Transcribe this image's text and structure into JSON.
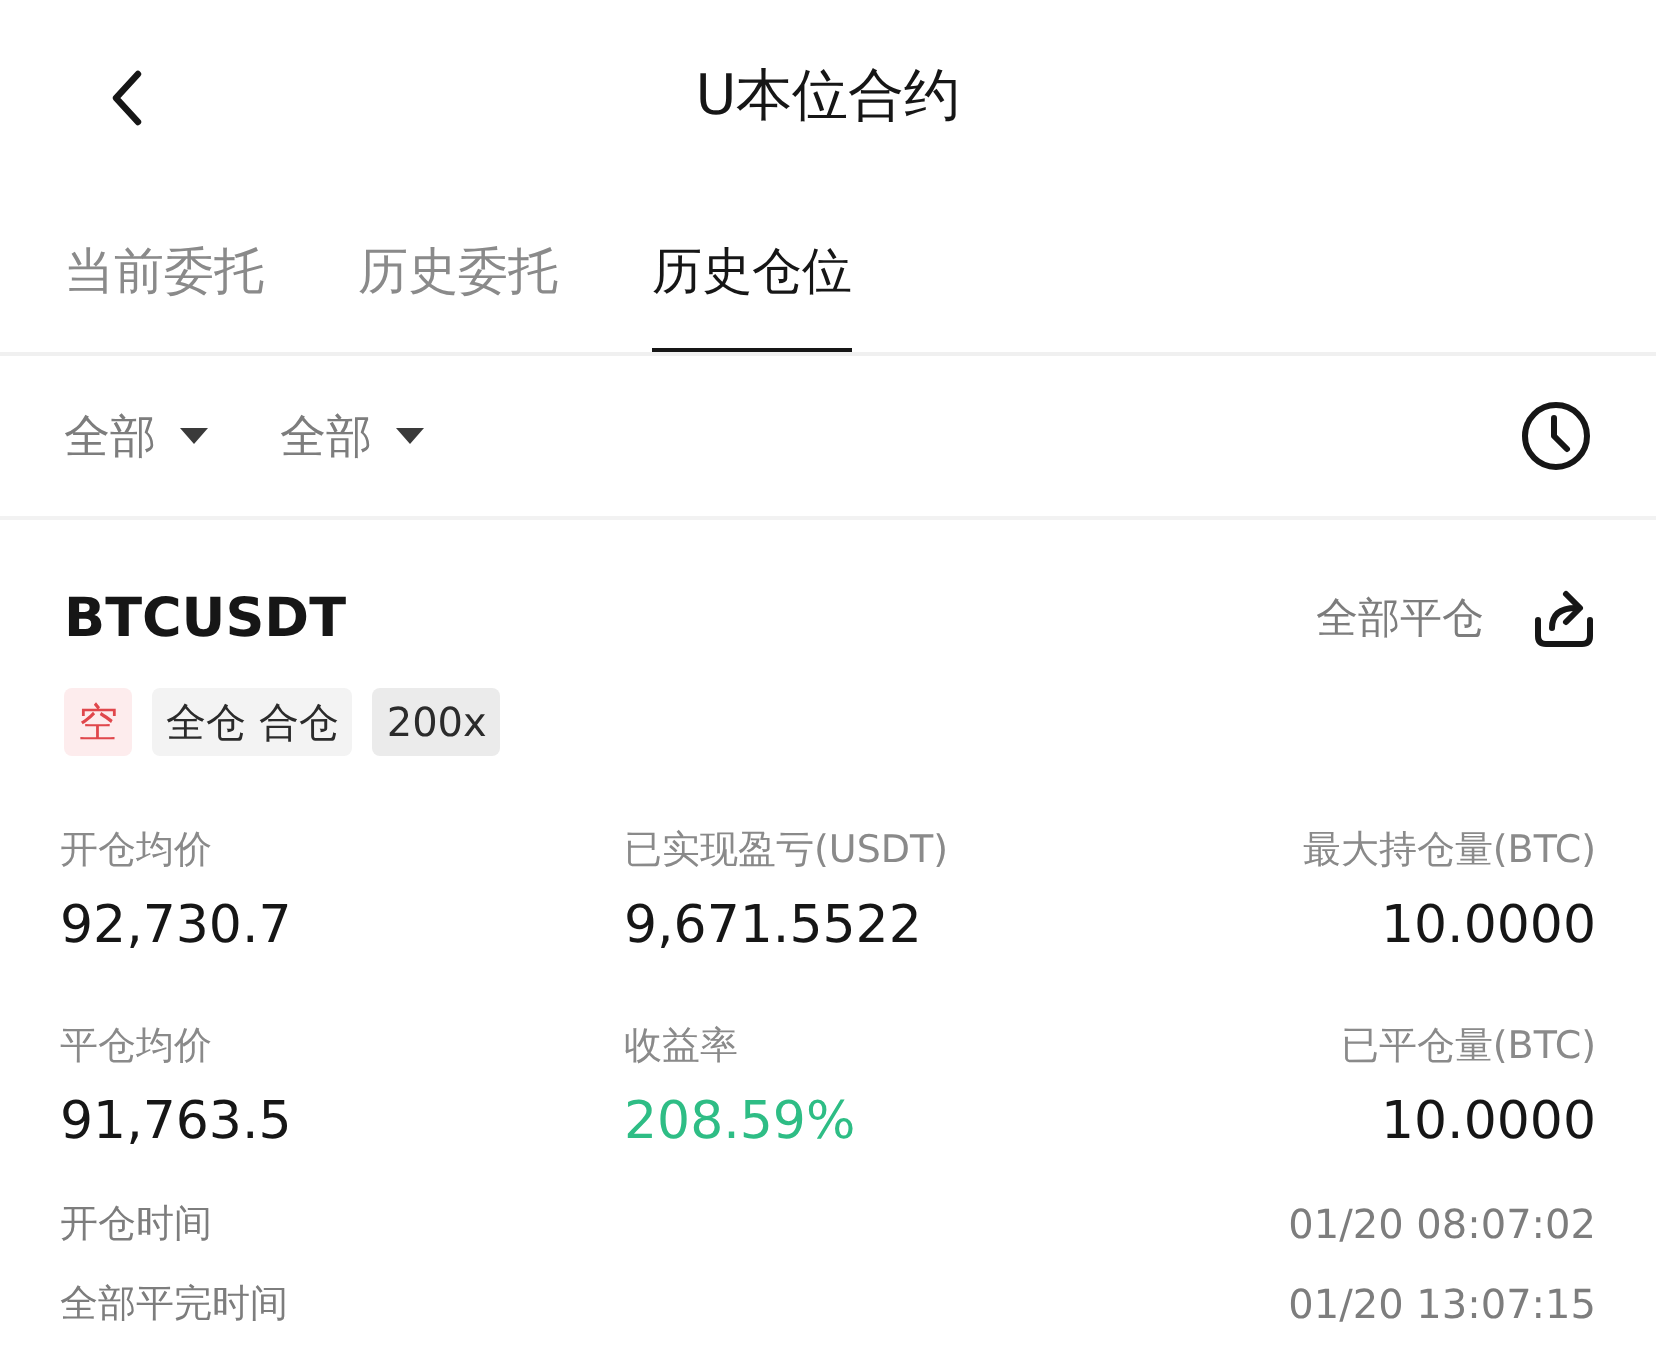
{
  "header": {
    "title": "U本位合约"
  },
  "tabs": [
    {
      "label": "当前委托",
      "selected": false
    },
    {
      "label": "历史委托",
      "selected": false
    },
    {
      "label": "历史仓位",
      "selected": true
    }
  ],
  "filters": [
    {
      "label": "全部"
    },
    {
      "label": "全部"
    }
  ],
  "position": {
    "symbol": "BTCUSDT",
    "close_all": "全部平仓",
    "tags": [
      {
        "label": "空",
        "kind": "side"
      },
      {
        "label": "全仓 合仓",
        "kind": "mode"
      },
      {
        "label": "200x",
        "kind": "leverage"
      }
    ],
    "stats": [
      {
        "label": "开仓均价",
        "value": "92,730.7",
        "positive": false
      },
      {
        "label": "已实现盈亏(USDT)",
        "value": "9,671.5522",
        "positive": false
      },
      {
        "label": "最大持仓量(BTC)",
        "value": "10.0000",
        "positive": false
      },
      {
        "label": "平仓均价",
        "value": "91,763.5",
        "positive": false
      },
      {
        "label": "收益率",
        "value": "208.59%",
        "positive": true
      },
      {
        "label": "已平仓量(BTC)",
        "value": "10.0000",
        "positive": false
      }
    ],
    "times": [
      {
        "label": "开仓时间",
        "value": "01/20 08:07:02"
      },
      {
        "label": "全部平完时间",
        "value": "01/20 13:07:15"
      }
    ]
  }
}
